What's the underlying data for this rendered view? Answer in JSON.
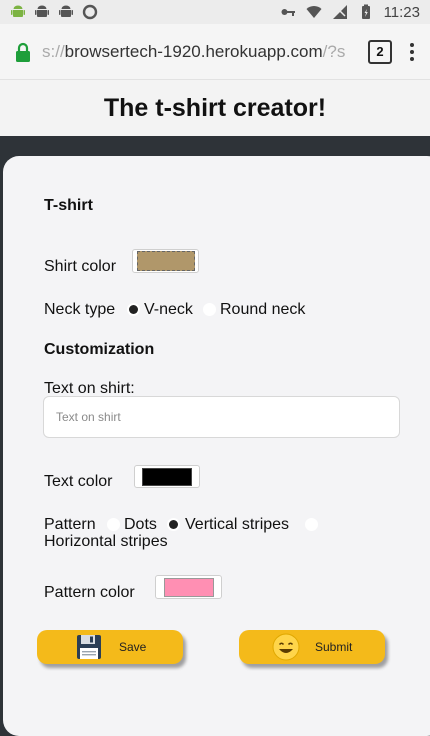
{
  "status_bar": {
    "time": "11:23",
    "left_icons": [
      "android-icon",
      "android-icon",
      "android-icon",
      "circle-icon"
    ],
    "right_icons": [
      "key-icon",
      "wifi-icon",
      "signal-icon",
      "battery-icon"
    ]
  },
  "browser": {
    "url_prefix": "s://",
    "url_host": "browsertech-1920.herokuapp.com",
    "url_rest": "/?s",
    "tab_count": "2"
  },
  "page": {
    "title": "The t-shirt creator!"
  },
  "form": {
    "tshirt_heading": "T-shirt",
    "shirt_color_label": "Shirt color",
    "shirt_color": "#b0976a",
    "neck_type_label": "Neck type",
    "neck_options": [
      {
        "label": "V-neck",
        "selected": true
      },
      {
        "label": "Round neck",
        "selected": false
      }
    ],
    "customization_heading": "Customization",
    "text_on_shirt_label": "Text on shirt:",
    "text_on_shirt_placeholder": "Text on shirt",
    "text_on_shirt_value": "",
    "text_color_label": "Text color",
    "text_color": "#000000",
    "pattern_label": "Pattern",
    "pattern_options": [
      {
        "label": "Dots",
        "selected": false
      },
      {
        "label": "Vertical stripes",
        "selected": true
      },
      {
        "label": "Horizontal stripes",
        "selected": false
      }
    ],
    "pattern_color_label": "Pattern color",
    "pattern_color": "#ff8fb3"
  },
  "buttons": {
    "save_label": "Save",
    "submit_label": "Submit",
    "accent": "#f4ba1a"
  }
}
